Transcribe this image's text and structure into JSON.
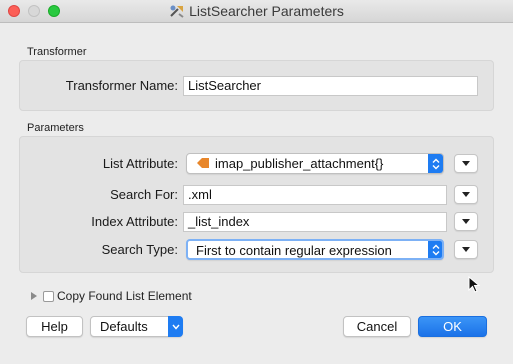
{
  "window": {
    "title": "ListSearcher Parameters"
  },
  "transformer_section": {
    "label": "Transformer",
    "name_label": "Transformer Name:",
    "name_value": "ListSearcher"
  },
  "parameters_section": {
    "label": "Parameters",
    "list_attribute": {
      "label": "List Attribute:",
      "value": "imap_publisher_attachment{}"
    },
    "search_for": {
      "label": "Search For:",
      "value": ".xml"
    },
    "index_attribute": {
      "label": "Index Attribute:",
      "value": "_list_index"
    },
    "search_type": {
      "label": "Search Type:",
      "value": "First to contain regular expression"
    }
  },
  "copy_found": {
    "label": "Copy Found List Element",
    "checked": false
  },
  "footer": {
    "help": "Help",
    "defaults": "Defaults",
    "cancel": "Cancel",
    "ok": "OK"
  },
  "colors": {
    "accent": "#1e7cf2",
    "attr_icon": "#e8862a"
  }
}
